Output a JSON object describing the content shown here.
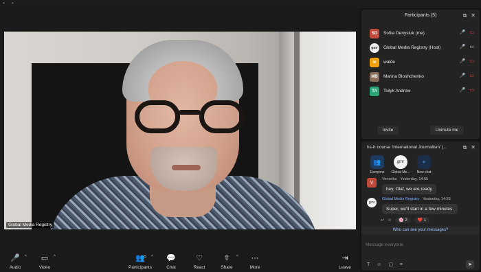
{
  "video": {
    "name_tag": "Global Media Registry"
  },
  "toolbar": {
    "audio": "Audio",
    "video": "Video",
    "participants": "Participants",
    "participants_count": "5",
    "chat": "Chat",
    "react": "React",
    "share": "Share",
    "more": "More",
    "leave": "Leave"
  },
  "participants_panel": {
    "title": "Participants (5)",
    "items": [
      {
        "initials": "SD",
        "name": "Sofiia Denysiuk (me)",
        "avatar_color": "#c24a3b"
      },
      {
        "initials": "gmr",
        "name": "Global Media Registry (Host)",
        "avatar_color": "#f2f2f2"
      },
      {
        "initials": "w",
        "name": "walde",
        "avatar_color": "#f0a20e"
      },
      {
        "initials": "MB",
        "name": "Marina Bloshchenko",
        "avatar_color": "#8a6d5a"
      },
      {
        "initials": "TA",
        "name": "Tsilyk Andrew",
        "avatar_color": "#2aa377"
      }
    ],
    "invite": "Invite",
    "unmute": "Unmute me"
  },
  "chat_panel": {
    "title": "hs-h course 'International Journalism' (...",
    "targets": [
      {
        "label": "Everyone",
        "icon": "people-icon"
      },
      {
        "label": "Global Me...",
        "icon": "gmr-logo"
      },
      {
        "label": "New chat",
        "icon": "plus-icon"
      }
    ],
    "messages": [
      {
        "initial": "V",
        "sender": "Veronika",
        "time": "Yesterday, 14:55",
        "text": "hey, Olaf, we are ready",
        "avatar_color": "#c24a3b"
      },
      {
        "initial": "gmr",
        "sender": "Global Media Registry",
        "time": "Yesterday, 14:55",
        "text": "Super, we'll start in a few minutes.",
        "avatar_color": "#f2f2f2"
      }
    ],
    "reactions": [
      {
        "emoji": "🌸",
        "count": "2"
      },
      {
        "emoji": "❤️",
        "count": "1"
      }
    ],
    "who_can_see": "Who can see your messages?",
    "placeholder": "Message everyone"
  }
}
